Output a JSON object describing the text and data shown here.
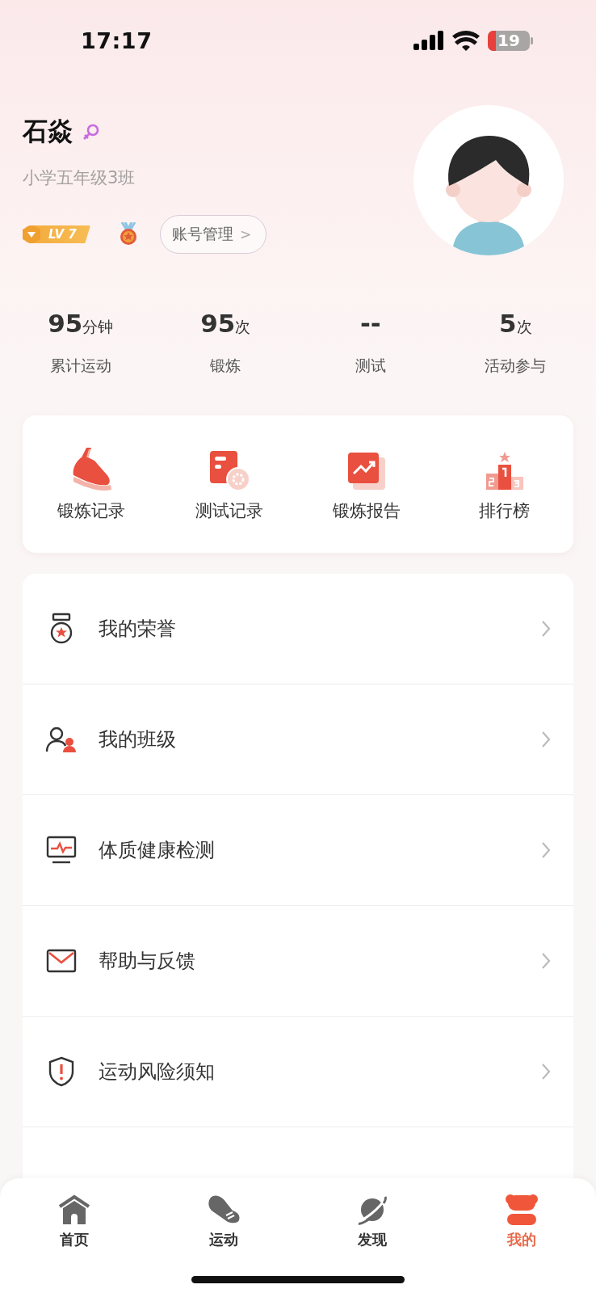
{
  "status_bar": {
    "time": "17:17",
    "battery": "19"
  },
  "profile": {
    "name": "石焱",
    "class": "小学五年级3班",
    "rank_badge": "LV 7",
    "account_button": "账号管理",
    "account_chevron": ">"
  },
  "stats": [
    {
      "value": "95",
      "unit": "分钟",
      "label": "累计运动"
    },
    {
      "value": "95",
      "unit": "次",
      "label": "锻炼"
    },
    {
      "value": "--",
      "label": "测试"
    },
    {
      "value": "5",
      "unit": "次",
      "label": "活动参与"
    }
  ],
  "shortcuts": [
    {
      "label": "锻炼记录"
    },
    {
      "label": "测试记录"
    },
    {
      "label": "锻炼报告"
    },
    {
      "label": "排行榜"
    }
  ],
  "menu": [
    {
      "label": "我的荣誉"
    },
    {
      "label": "我的班级"
    },
    {
      "label": "体质健康检测"
    },
    {
      "label": "帮助与反馈"
    },
    {
      "label": "运动风险须知"
    }
  ],
  "tab_bar": [
    {
      "label": "首页",
      "selected": false
    },
    {
      "label": "运动",
      "selected": false
    },
    {
      "label": "发现",
      "selected": false
    },
    {
      "label": "我的",
      "selected": true
    }
  ]
}
